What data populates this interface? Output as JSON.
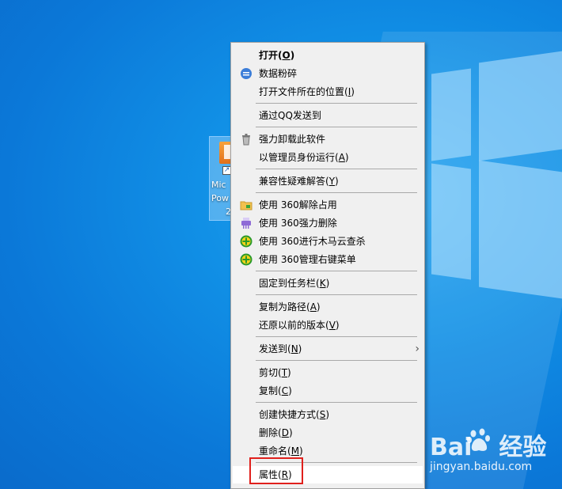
{
  "desktop_icon": {
    "label_lines": [
      "Mic",
      "Pow",
      "2"
    ]
  },
  "menu": {
    "items": [
      {
        "text": "打开(",
        "key": "O",
        "end": ")",
        "icon": "",
        "bold": true
      },
      {
        "text": "数据粉碎",
        "key": "",
        "end": "",
        "icon": "shred-icon"
      },
      {
        "text": "打开文件所在的位置(",
        "key": "I",
        "end": ")",
        "icon": ""
      },
      {
        "text": "通过QQ发送到",
        "key": "",
        "end": "",
        "icon": ""
      },
      {
        "text": "强力卸载此软件",
        "key": "",
        "end": "",
        "icon": "trash-icon"
      },
      {
        "text": "以管理员身份运行(",
        "key": "A",
        "end": ")",
        "icon": ""
      },
      {
        "text": "兼容性疑难解答(",
        "key": "Y",
        "end": ")",
        "icon": ""
      },
      {
        "text": "使用 360解除占用",
        "key": "",
        "end": "",
        "icon": "unlock-folder-icon"
      },
      {
        "text": "使用 360强力删除",
        "key": "",
        "end": "",
        "icon": "shredder-icon"
      },
      {
        "text": "使用 360进行木马云查杀",
        "key": "",
        "end": "",
        "icon": "360-shield-icon"
      },
      {
        "text": "使用 360管理右键菜单",
        "key": "",
        "end": "",
        "icon": "360-shield-icon"
      },
      {
        "text": "固定到任务栏(",
        "key": "K",
        "end": ")",
        "icon": ""
      },
      {
        "text": "复制为路径(",
        "key": "A",
        "end": ")",
        "icon": ""
      },
      {
        "text": "还原以前的版本(",
        "key": "V",
        "end": ")",
        "icon": ""
      },
      {
        "text": "发送到(",
        "key": "N",
        "end": ")",
        "icon": "",
        "submenu": true
      },
      {
        "text": "剪切(",
        "key": "T",
        "end": ")",
        "icon": ""
      },
      {
        "text": "复制(",
        "key": "C",
        "end": ")",
        "icon": ""
      },
      {
        "text": "创建快捷方式(",
        "key": "S",
        "end": ")",
        "icon": ""
      },
      {
        "text": "删除(",
        "key": "D",
        "end": ")",
        "icon": ""
      },
      {
        "text": "重命名(",
        "key": "M",
        "end": ")",
        "icon": ""
      },
      {
        "text": "属性(",
        "key": "R",
        "end": ")",
        "icon": "",
        "highlight": true
      }
    ]
  },
  "watermark": {
    "logo_left": "Bai",
    "logo_right": "经验",
    "site": "jingyan.baidu.com"
  },
  "colors": {
    "menu_bg": "#f0f0f0",
    "highlight_box": "#e0201c",
    "desktop_blue": "#0b78d8"
  }
}
